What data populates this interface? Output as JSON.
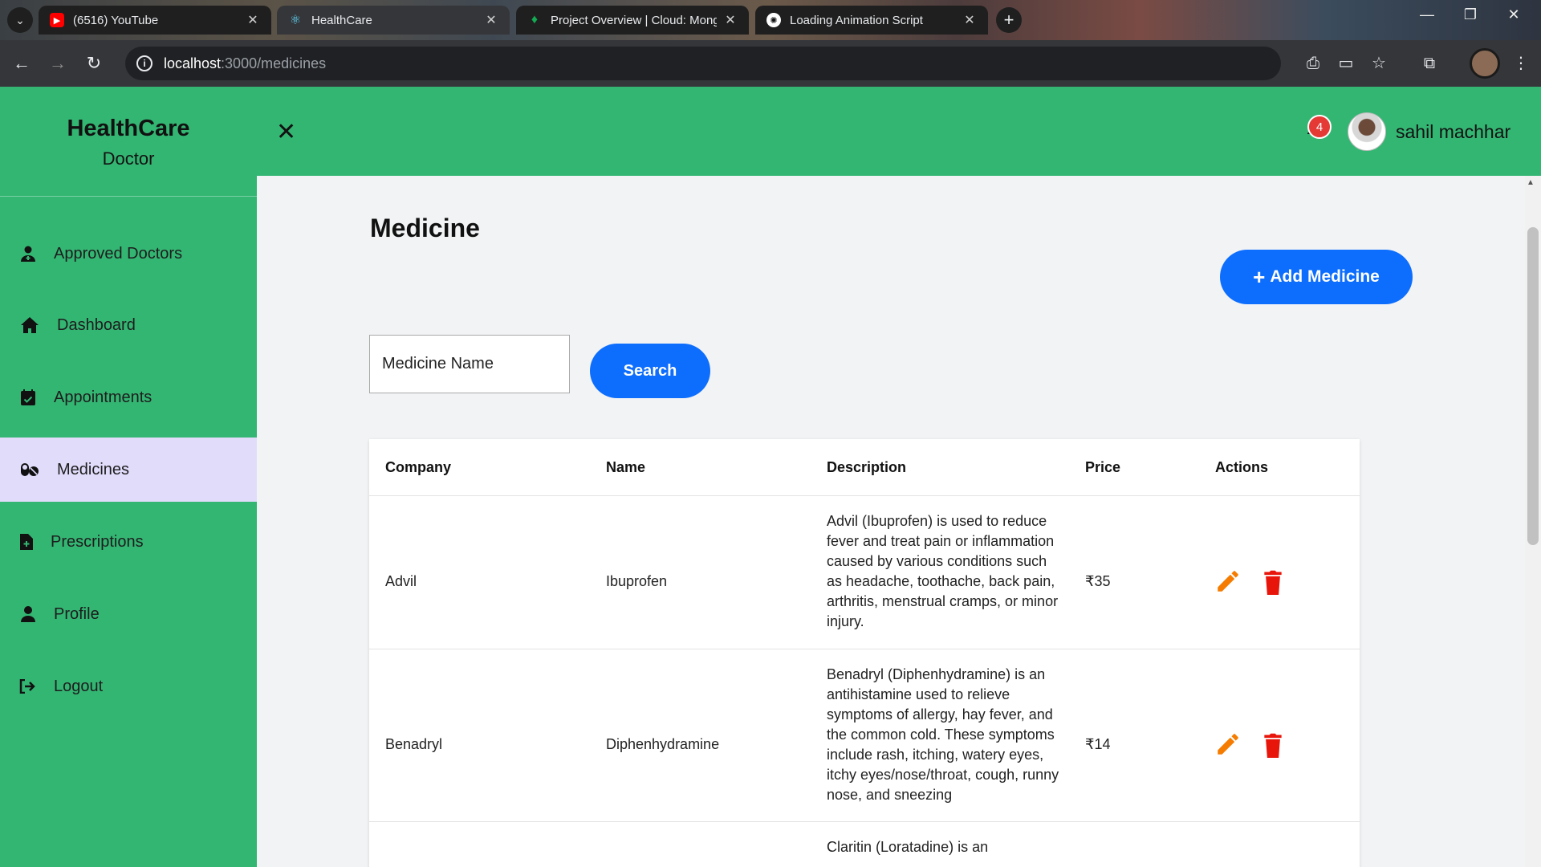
{
  "browser": {
    "tabs": [
      {
        "title": "(6516) YouTube",
        "icon": "youtube-icon"
      },
      {
        "title": "HealthCare",
        "icon": "react-icon"
      },
      {
        "title": "Project Overview | Cloud: MongoDB Cloud",
        "icon": "mongodb-leaf-icon"
      },
      {
        "title": "Loading Animation Script",
        "icon": "chatgpt-icon"
      }
    ],
    "url_host": "localhost",
    "url_path": ":3000/medicines"
  },
  "app": {
    "brand_name": "HealthCare",
    "brand_role": "Doctor",
    "notification_count": "4",
    "user_name": "sahil machhar"
  },
  "sidebar": {
    "items": [
      {
        "label": "Approved Doctors",
        "icon": "user-doctor-icon"
      },
      {
        "label": "Dashboard",
        "icon": "home-icon"
      },
      {
        "label": "Appointments",
        "icon": "calendar-check-icon"
      },
      {
        "label": "Medicines",
        "icon": "capsules-icon",
        "active": true
      },
      {
        "label": "Prescriptions",
        "icon": "file-medical-icon"
      },
      {
        "label": "Profile",
        "icon": "user-icon"
      },
      {
        "label": "Logout",
        "icon": "logout-icon"
      }
    ]
  },
  "page": {
    "title": "Medicine",
    "add_button": "Add Medicine",
    "search_placeholder": "Medicine Name",
    "search_button": "Search"
  },
  "table": {
    "headers": {
      "company": "Company",
      "name": "Name",
      "description": "Description",
      "price": "Price",
      "actions": "Actions"
    },
    "rows": [
      {
        "company": "Advil",
        "name": "Ibuprofen",
        "description": "Advil (Ibuprofen) is used to reduce fever and treat pain or inflammation caused by various conditions such as headache, toothache, back pain, arthritis, menstrual cramps, or minor injury.",
        "price": "₹35"
      },
      {
        "company": "Benadryl",
        "name": "Diphenhydramine",
        "description": "Benadryl (Diphenhydramine) is an antihistamine used to relieve symptoms of allergy, hay fever, and the common cold. These symptoms include rash, itching, watery eyes, itchy eyes/nose/throat, cough, runny nose, and sneezing",
        "price": "₹14"
      },
      {
        "company": "",
        "name": "",
        "description": "Claritin (Loratadine) is an",
        "price": ""
      }
    ]
  },
  "colors": {
    "primary_green": "#34b673",
    "active_nav": "#e2dcfb",
    "button_blue": "#0d6efd",
    "edit_orange": "#f57c00",
    "delete_red": "#e8150b"
  }
}
